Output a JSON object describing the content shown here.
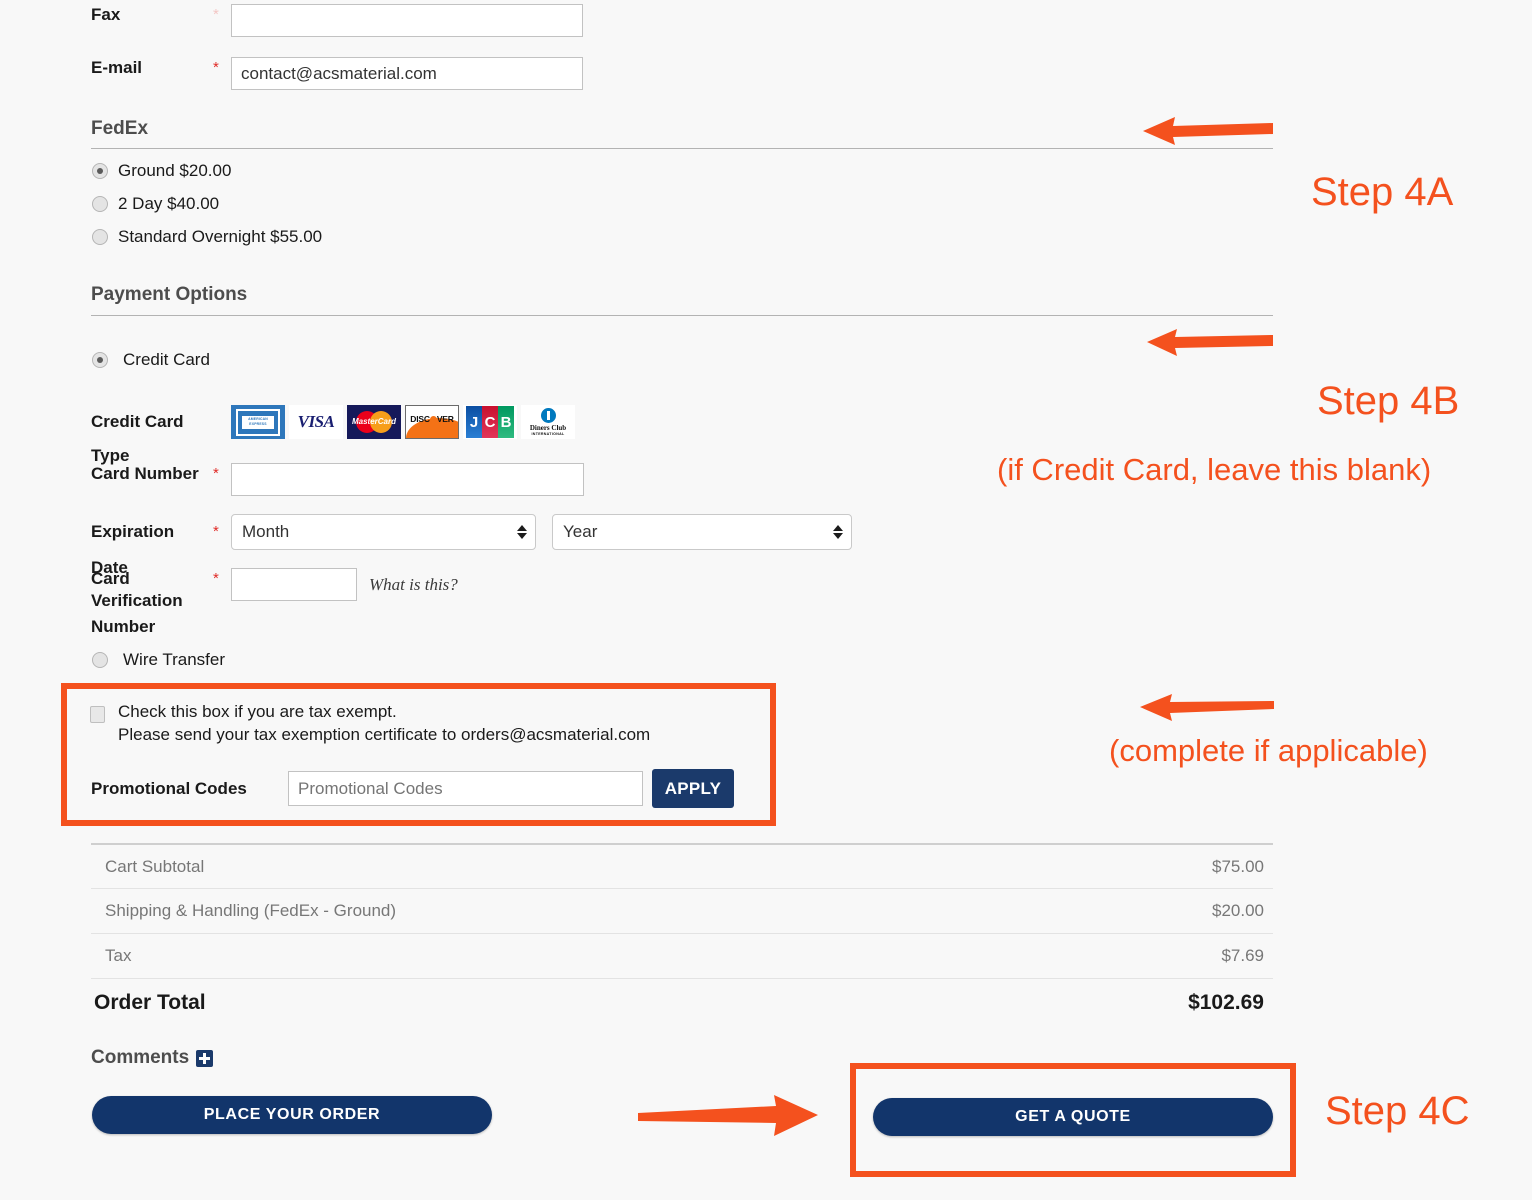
{
  "form": {
    "fax": {
      "label": "Fax",
      "required_marker": "*",
      "value": "",
      "placeholder": ""
    },
    "email": {
      "label": "E-mail",
      "required_marker": "*",
      "value": "contact@acsmaterial.com",
      "placeholder": ""
    }
  },
  "shipping": {
    "heading": "FedEx",
    "options": [
      {
        "label": "Ground $20.00",
        "selected": true
      },
      {
        "label": "2 Day $40.00",
        "selected": false
      },
      {
        "label": "Standard Overnight $55.00",
        "selected": false
      }
    ]
  },
  "payment": {
    "heading": "Payment Options",
    "methods": [
      {
        "label": "Credit Card",
        "selected": true
      },
      {
        "label": "Wire Transfer",
        "selected": false
      }
    ],
    "card_type": {
      "label": "Credit Card Type",
      "cards": [
        {
          "name": "american-express",
          "text": "AMERICAN EXPRESS"
        },
        {
          "name": "visa",
          "text": "VISA"
        },
        {
          "name": "mastercard",
          "text": "MasterCard"
        },
        {
          "name": "discover",
          "text": "DISCOVER"
        },
        {
          "name": "jcb",
          "text": "JCB"
        },
        {
          "name": "diners-club",
          "text": "Diners Club",
          "sub": "INTERNATIONAL"
        }
      ]
    },
    "card_number": {
      "label": "Card Number",
      "required_marker": "*",
      "value": ""
    },
    "expiration": {
      "label": "Expiration Date",
      "required_marker": "*",
      "month_value": "Month",
      "year_value": "Year"
    },
    "cvn": {
      "label_line1": "Card Verification",
      "label_line2": "Number",
      "required_marker": "*",
      "value": "",
      "help_link": "What is this?"
    }
  },
  "tax_exempt": {
    "line1": "Check this box if you are tax exempt.",
    "line2": "Please send your tax exemption certificate to orders@acsmaterial.com",
    "checked": false
  },
  "promo": {
    "label": "Promotional Codes",
    "placeholder": "Promotional Codes",
    "value": "",
    "apply_label": "APPLY"
  },
  "totals": {
    "rows": [
      {
        "label": "Cart Subtotal",
        "value": "$75.00"
      },
      {
        "label": "Shipping & Handling (FedEx - Ground)",
        "value": "$20.00"
      },
      {
        "label": "Tax",
        "value": "$7.69"
      }
    ],
    "grand": {
      "label": "Order Total",
      "value": "$102.69"
    }
  },
  "comments": {
    "label": "Comments",
    "toggle_icon": "plus-icon"
  },
  "actions": {
    "place_order": "PLACE YOUR ORDER",
    "get_quote": "GET A QUOTE"
  },
  "annotations": {
    "step4a": "Step 4A",
    "step4b": "Step 4B",
    "step4b_note": "(if Credit Card, leave this blank)",
    "complete_if_applicable": "(complete if applicable)",
    "step4c": "Step 4C"
  },
  "colors": {
    "accent_orange": "#f4511e",
    "brand_navy": "#12356b",
    "required_red": "#e02b27"
  }
}
